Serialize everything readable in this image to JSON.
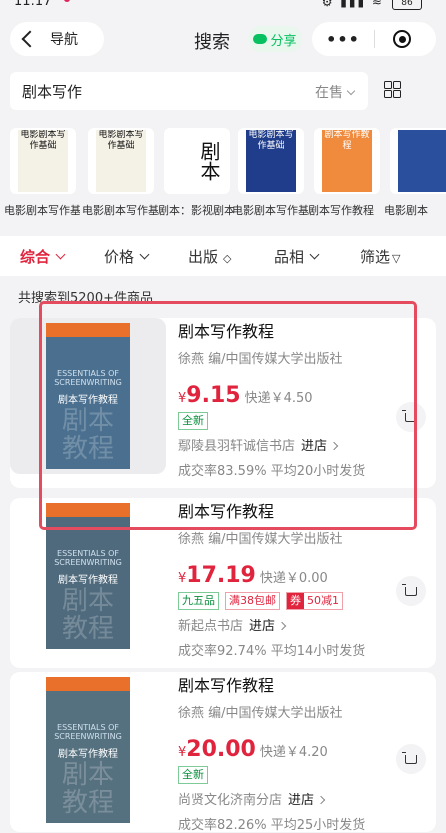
{
  "status_bar": {
    "time": "11:17",
    "signal_icons": "⚙ ▮▮▮ ≈",
    "battery": "86"
  },
  "nav": {
    "back_label": "导航",
    "title": "搜索",
    "share_label": "分享",
    "menu_dots": "•••"
  },
  "search": {
    "query": "剧本写作",
    "filter_label": "在售"
  },
  "thumbs": [
    {
      "caption": "电影剧本写作基础",
      "cover_text": "电影剧本写作基础",
      "bg": "#f4f1e6"
    },
    {
      "caption": "电影剧本写作基础",
      "cover_text": "电影剧本写作基础",
      "bg": "#f4f1e6"
    },
    {
      "caption": "剧本：影视剧本创作",
      "cover_text": "剧本",
      "bg": "#ffffff"
    },
    {
      "caption": "电影剧本写作基础",
      "cover_text": "电影剧本写作基础",
      "bg": "#1f3d8a"
    },
    {
      "caption": "剧本写作教程",
      "cover_text": "剧本写作教程",
      "bg": "#f08a3c"
    },
    {
      "caption": "电影剧本",
      "cover_text": "",
      "bg": "#2a4f9c"
    }
  ],
  "tabs": [
    {
      "label": "综合",
      "active": true
    },
    {
      "label": "价格",
      "active": false
    },
    {
      "label": "出版",
      "active": false
    },
    {
      "label": "品相",
      "active": false
    },
    {
      "label": "筛选",
      "active": false
    }
  ],
  "result_count": "共搜索到5200+件商品",
  "products": [
    {
      "title": "剧本写作教程",
      "author": "徐燕 编/中国传媒大学出版社",
      "price": "9.15",
      "shipping": "快递￥4.50",
      "tags": [
        {
          "text": "全新",
          "style": "green"
        }
      ],
      "shop": "鄢陵县羽轩诚信书店",
      "enter_label": "进店",
      "stats": "成交率83.59%  平均20小时发货",
      "cover": {
        "en": "ESSENTIALS OF SCREENWRITING",
        "zh": "剧本写作教程",
        "big": "剧本教程",
        "color": "#4a6f8f",
        "accent": "#e8702a"
      }
    },
    {
      "title": "剧本写作教程",
      "author": "徐燕 编/中国传媒大学出版社",
      "price": "17.19",
      "shipping": "快递￥0.00",
      "tags": [
        {
          "text": "九五品",
          "style": "green"
        },
        {
          "text": "满38包邮",
          "style": "red"
        },
        {
          "text": "50减1",
          "style": "coupon",
          "label": "券"
        }
      ],
      "shop": "新起点书店",
      "enter_label": "进店",
      "stats": "成交率92.74%  平均14小时发货",
      "cover": {
        "en": "ESSENTIALS OF SCREENWRITING",
        "zh": "剧本写作教程",
        "big": "剧本教程",
        "color": "#4f6a7d",
        "accent": "#e8702a"
      }
    },
    {
      "title": "剧本写作教程",
      "author": "徐燕 编/中国传媒大学出版社",
      "price": "20.00",
      "shipping": "快递￥4.20",
      "tags": [
        {
          "text": "全新",
          "style": "green"
        }
      ],
      "shop": "尚贤文化济南分店",
      "enter_label": "进店",
      "stats": "成交率82.26%  平均25小时发货",
      "cover": {
        "en": "ESSENTIALS OF SCREENWRITING",
        "zh": "剧本写作教程",
        "big": "剧本教程",
        "color": "#55707f",
        "accent": "#e8702a"
      }
    }
  ],
  "colors": {
    "accent": "#e0243e",
    "green": "#07c160",
    "highlight": "#e54b5e"
  },
  "icons": {
    "back": "chevron-left-icon",
    "share": "wechat-icon",
    "menu": "more-icon",
    "close": "target-icon",
    "layout": "grid-icon",
    "cart": "cart-icon"
  }
}
